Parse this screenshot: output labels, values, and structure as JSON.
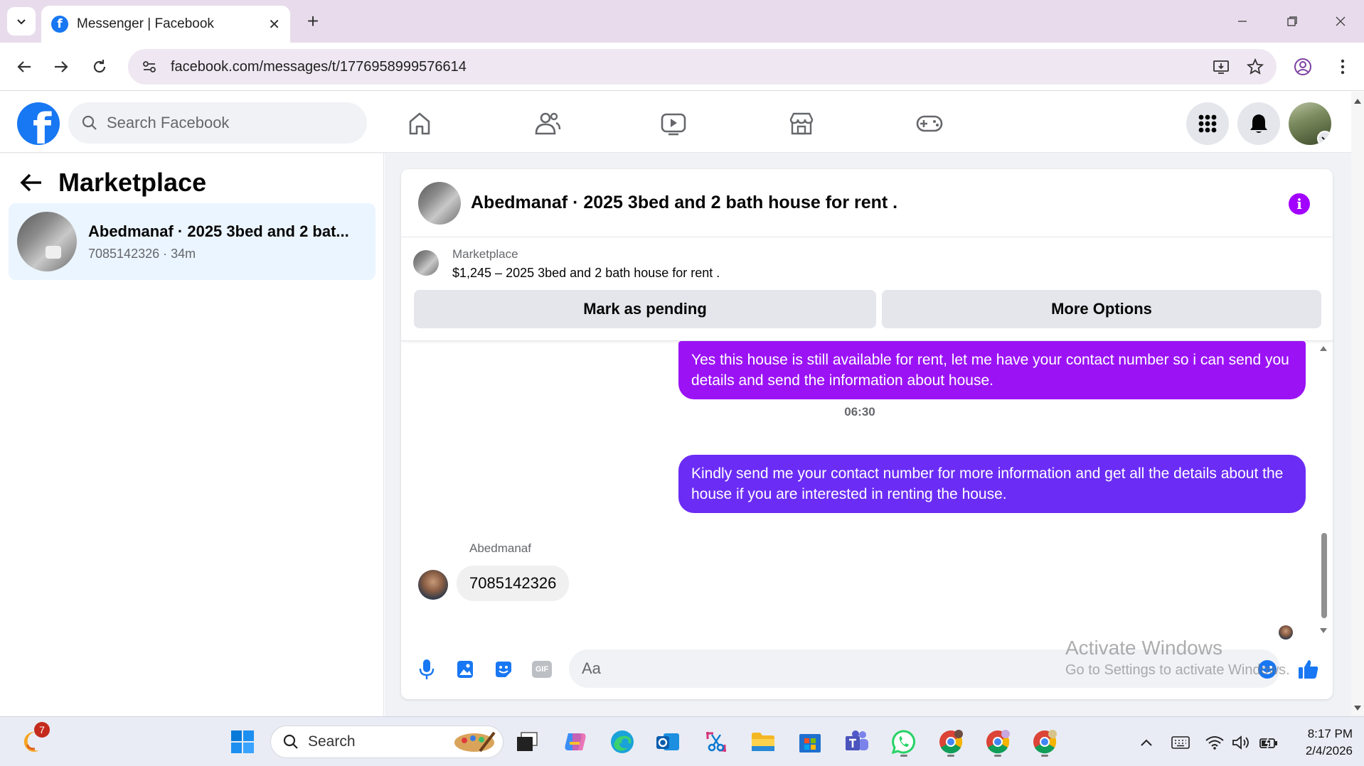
{
  "browser": {
    "tab_title": "Messenger | Facebook",
    "url": "facebook.com/messages/t/1776958999576614"
  },
  "fb": {
    "search_placeholder": "Search Facebook"
  },
  "left": {
    "title": "Marketplace",
    "conversation": {
      "title": "Abedmanaf · 2025 3bed and 2 bat...",
      "subtitle": "7085142326 · 34m"
    }
  },
  "chat": {
    "header_title": "Abedmanaf · 2025 3bed and 2 bath house for rent .",
    "listing": {
      "label": "Marketplace",
      "price_line": "$1,245 – 2025 3bed and 2 bath house for rent ."
    },
    "buttons": {
      "pending": "Mark as pending",
      "more": "More Options"
    },
    "messages": {
      "out1": "Yes this house is still available for rent, let me have your contact number so i can send you details and send the information about house.",
      "timestamp": "06:30",
      "out2": "Kindly send me your contact number for more information and get all the details about the house if you are interested in renting the house.",
      "sender": "Abedmanaf",
      "in1": "7085142326"
    },
    "composer_placeholder": "Aa",
    "gif_label": "GIF"
  },
  "watermark": {
    "line1": "Activate Windows",
    "line2": "Go to Settings to activate Windows."
  },
  "taskbar": {
    "search_label": "Search",
    "notification_count": "7",
    "time": "8:17 PM",
    "date": "2/4/2026"
  },
  "colors": {
    "fb_blue": "#1877f2",
    "bubble_purple": "#9b13f5",
    "bubble_violet": "#6b2cf5",
    "info_purple": "#a200ff"
  }
}
